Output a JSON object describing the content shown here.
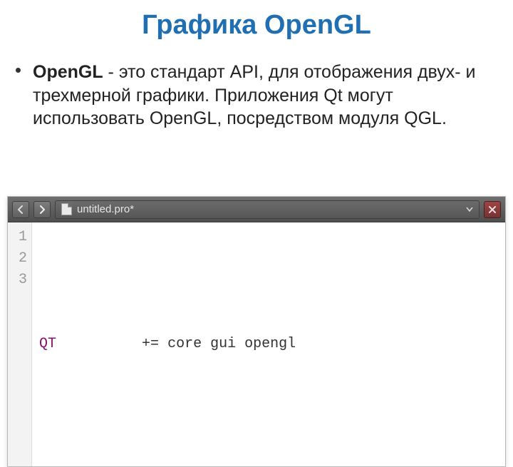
{
  "slide": {
    "title": "Графика OpenGL",
    "bullet": {
      "bold_lead": "OpenGL",
      "rest": " - это стандарт API, для отображения двух- и трехмерной графики. Приложения Qt могут использовать OpenGL, посредством модуля QGL."
    }
  },
  "ide": {
    "breadcrumb": "untitled.pro*",
    "gutter": [
      "1",
      "2",
      "3"
    ],
    "code": {
      "keyword": "QT",
      "spacer": "          ",
      "operator": "+=",
      "rest": " core gui opengl"
    }
  }
}
